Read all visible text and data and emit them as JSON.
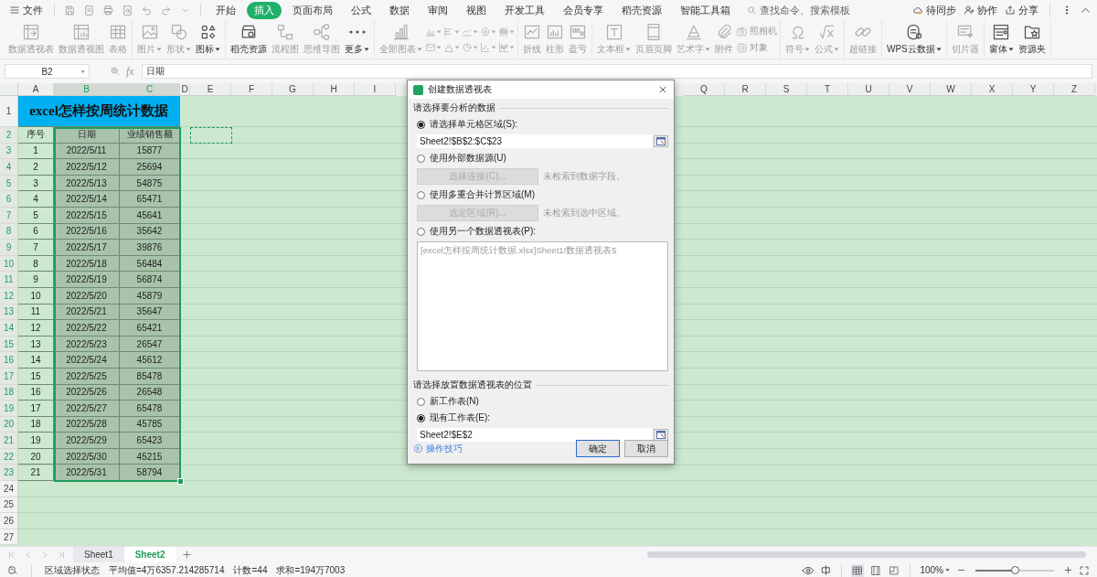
{
  "menu_bar": {
    "file_menu": "文件",
    "tabs": [
      {
        "label": "开始",
        "selected": false
      },
      {
        "label": "插入",
        "selected": true
      },
      {
        "label": "页面布局",
        "selected": false
      },
      {
        "label": "公式",
        "selected": false
      },
      {
        "label": "数据",
        "selected": false
      },
      {
        "label": "审阅",
        "selected": false
      },
      {
        "label": "视图",
        "selected": false
      },
      {
        "label": "开发工具",
        "selected": false
      },
      {
        "label": "会员专享",
        "selected": false
      },
      {
        "label": "稻壳资源",
        "selected": false
      },
      {
        "label": "智能工具箱",
        "selected": false
      }
    ],
    "search": {
      "placeholder": "查找命令、搜索模板"
    },
    "actions": [
      "待同步",
      "协作",
      "分享"
    ]
  },
  "ribbon": {
    "groups": [
      {
        "items": [
          {
            "kind": "large",
            "label": "数据透视表",
            "disabled": true,
            "dropdown": false
          },
          {
            "kind": "large",
            "label": "数据透视图",
            "disabled": true,
            "dropdown": false
          },
          {
            "kind": "large",
            "label": "表格",
            "disabled": true,
            "dropdown": false
          }
        ]
      },
      {
        "items": [
          {
            "kind": "large",
            "label": "图片",
            "disabled": true,
            "dropdown": true
          },
          {
            "kind": "large",
            "label": "形状",
            "disabled": true,
            "dropdown": true
          },
          {
            "kind": "large",
            "label": "图标",
            "disabled": false,
            "dropdown": true
          }
        ]
      },
      {
        "items": [
          {
            "kind": "large",
            "label": "稻壳资源",
            "disabled": false,
            "dropdown": false
          },
          {
            "kind": "large",
            "label": "流程图",
            "disabled": true,
            "dropdown": false
          },
          {
            "kind": "large",
            "label": "思维导图",
            "disabled": true,
            "dropdown": false
          },
          {
            "kind": "large",
            "label": "更多",
            "disabled": false,
            "dropdown": true
          }
        ]
      },
      {
        "items": [
          {
            "kind": "large",
            "label": "全部图表",
            "disabled": true,
            "dropdown": true
          },
          {
            "kind": "small",
            "disabled": true,
            "dropdown": true
          },
          {
            "kind": "small",
            "disabled": true,
            "dropdown": true
          },
          {
            "kind": "small",
            "disabled": true,
            "dropdown": true
          },
          {
            "kind": "small",
            "disabled": true,
            "dropdown": true
          },
          {
            "kind": "small",
            "disabled": true,
            "dropdown": true
          },
          {
            "kind": "small",
            "disabled": true,
            "dropdown": true
          },
          {
            "kind": "small",
            "disabled": true,
            "dropdown": true
          },
          {
            "kind": "small",
            "disabled": true,
            "dropdown": true
          },
          {
            "kind": "small",
            "disabled": true,
            "dropdown": true
          },
          {
            "kind": "small",
            "disabled": true,
            "dropdown": true
          }
        ]
      },
      {
        "items": [
          {
            "kind": "large",
            "label": "折线",
            "disabled": true,
            "dropdown": false
          },
          {
            "kind": "large",
            "label": "柱形",
            "disabled": true,
            "dropdown": false
          },
          {
            "kind": "large",
            "label": "盈亏",
            "disabled": true,
            "dropdown": false
          }
        ]
      },
      {
        "items": [
          {
            "kind": "large",
            "label": "文本框",
            "disabled": true,
            "dropdown": true
          },
          {
            "kind": "large",
            "label": "页眉页脚",
            "disabled": true,
            "dropdown": false
          },
          {
            "kind": "large",
            "label": "艺术字",
            "disabled": true,
            "dropdown": true
          },
          {
            "kind": "large",
            "label": "附件",
            "disabled": true,
            "dropdown": false
          },
          {
            "kind": "compact",
            "label": "照相机",
            "disabled": true,
            "dropdown": false
          },
          {
            "kind": "compact",
            "label": "对象",
            "disabled": true,
            "dropdown": false
          }
        ]
      },
      {
        "items": [
          {
            "kind": "large",
            "label": "符号",
            "disabled": true,
            "dropdown": true
          },
          {
            "kind": "large",
            "label": "公式",
            "disabled": true,
            "dropdown": true
          }
        ]
      },
      {
        "items": [
          {
            "kind": "large",
            "label": "超链接",
            "disabled": true,
            "dropdown": false
          }
        ]
      },
      {
        "items": [
          {
            "kind": "large",
            "label": "WPS云数据",
            "disabled": false,
            "dropdown": true
          }
        ]
      },
      {
        "items": [
          {
            "kind": "large",
            "label": "切片器",
            "disabled": true,
            "dropdown": false
          }
        ]
      },
      {
        "items": [
          {
            "kind": "large",
            "label": "窗体",
            "disabled": false,
            "dropdown": true
          },
          {
            "kind": "large",
            "label": "资源夹",
            "disabled": false,
            "dropdown": false
          }
        ]
      }
    ]
  },
  "formula_bar": {
    "name_box": "B2",
    "function_label": "fx",
    "formula": "日期"
  },
  "sheet": {
    "columns": [
      {
        "label": "A",
        "selected": false
      },
      {
        "label": "B",
        "selected": true
      },
      {
        "label": "C",
        "selected": true
      },
      {
        "label": "D",
        "selected": false
      },
      {
        "label": "E",
        "selected": false
      },
      {
        "label": "F",
        "selected": false
      },
      {
        "label": "G",
        "selected": false
      },
      {
        "label": "H",
        "selected": false
      },
      {
        "label": "I",
        "selected": false
      },
      {
        "label": "Q",
        "selected": false
      },
      {
        "label": "R",
        "selected": false
      },
      {
        "label": "S",
        "selected": false
      },
      {
        "label": "T",
        "selected": false
      },
      {
        "label": "U",
        "selected": false
      },
      {
        "label": "V",
        "selected": false
      },
      {
        "label": "W",
        "selected": false
      },
      {
        "label": "X",
        "selected": false
      },
      {
        "label": "Y",
        "selected": false
      },
      {
        "label": "Z",
        "selected": false
      }
    ],
    "rows": [
      {
        "label": "1",
        "selected": false
      },
      {
        "label": "2",
        "selected": true
      },
      {
        "label": "3",
        "selected": true
      },
      {
        "label": "4",
        "selected": true
      },
      {
        "label": "5",
        "selected": true
      },
      {
        "label": "6",
        "selected": true
      },
      {
        "label": "7",
        "selected": true
      },
      {
        "label": "8",
        "selected": true
      },
      {
        "label": "9",
        "selected": true
      },
      {
        "label": "10",
        "selected": true
      },
      {
        "label": "11",
        "selected": true
      },
      {
        "label": "12",
        "selected": true
      },
      {
        "label": "13",
        "selected": true
      },
      {
        "label": "14",
        "selected": true
      },
      {
        "label": "15",
        "selected": true
      },
      {
        "label": "16",
        "selected": true
      },
      {
        "label": "17",
        "selected": true
      },
      {
        "label": "18",
        "selected": true
      },
      {
        "label": "19",
        "selected": true
      },
      {
        "label": "20",
        "selected": true
      },
      {
        "label": "21",
        "selected": true
      },
      {
        "label": "22",
        "selected": true
      },
      {
        "label": "23",
        "selected": true
      },
      {
        "label": "24",
        "selected": false
      },
      {
        "label": "25",
        "selected": false
      },
      {
        "label": "26",
        "selected": false
      },
      {
        "label": "27",
        "selected": false
      }
    ],
    "title": "excel怎样按周统计数据",
    "table_header": [
      "序号",
      "日期",
      "业绩销售额"
    ],
    "table_rows": [
      [
        "1",
        "2022/5/11",
        "15877"
      ],
      [
        "2",
        "2022/5/12",
        "25694"
      ],
      [
        "3",
        "2022/5/13",
        "54875"
      ],
      [
        "4",
        "2022/5/14",
        "65471"
      ],
      [
        "5",
        "2022/5/15",
        "45641"
      ],
      [
        "6",
        "2022/5/16",
        "35642"
      ],
      [
        "7",
        "2022/5/17",
        "39876"
      ],
      [
        "8",
        "2022/5/18",
        "56484"
      ],
      [
        "9",
        "2022/5/19",
        "56874"
      ],
      [
        "10",
        "2022/5/20",
        "45879"
      ],
      [
        "11",
        "2022/5/21",
        "35647"
      ],
      [
        "12",
        "2022/5/22",
        "65421"
      ],
      [
        "13",
        "2022/5/23",
        "26547"
      ],
      [
        "14",
        "2022/5/24",
        "45612"
      ],
      [
        "15",
        "2022/5/25",
        "85478"
      ],
      [
        "16",
        "2022/5/26",
        "26548"
      ],
      [
        "17",
        "2022/5/27",
        "65478"
      ],
      [
        "18",
        "2022/5/28",
        "45785"
      ],
      [
        "19",
        "2022/5/29",
        "65423"
      ],
      [
        "20",
        "2022/5/30",
        "45215"
      ],
      [
        "21",
        "2022/5/31",
        "58794"
      ]
    ]
  },
  "dialog": {
    "title": "创建数据透视表",
    "source_section": {
      "heading": "请选择要分析的数据",
      "options": [
        {
          "kind": "range",
          "label": "请选择单元格区域(S):",
          "selected": true,
          "value": "Sheet2!$B$2:$C$23"
        },
        {
          "kind": "button",
          "label": "使用外部数据源(U)",
          "selected": false,
          "button": {
            "label": "选择连接(C)...",
            "disabled": true
          },
          "note": "未检索到数据字段。"
        },
        {
          "kind": "button",
          "label": "使用多重合并计算区域(M)",
          "selected": false,
          "button": {
            "label": "选定区域(R)...",
            "disabled": true
          },
          "note": "未检索到选中区域。"
        },
        {
          "kind": "list",
          "label": "使用另一个数据透视表(P):",
          "selected": false,
          "disabled": true,
          "items": [
            "[excel怎样按周统计数据.xlsx]Sheet1!数据透视表5"
          ]
        }
      ]
    },
    "destination_section": {
      "heading": "请选择放置数据透视表的位置",
      "options": [
        {
          "label": "新工作表(N)",
          "selected": false
        },
        {
          "label": "现有工作表(E):",
          "selected": true
        }
      ],
      "value": "Sheet2!$E$2"
    },
    "tips_link": "操作技巧",
    "buttons": [
      {
        "label": "确定",
        "default": true
      },
      {
        "label": "取消",
        "default": false
      }
    ]
  },
  "sheet_tabs": [
    {
      "label": "Sheet1",
      "selected": false
    },
    {
      "label": "Sheet2",
      "selected": true
    }
  ],
  "status_bar": {
    "mode": "区域选择状态",
    "stats": [
      "平均值=4万6357.214285714",
      "计数=44",
      "求和=194万7003"
    ],
    "views": [
      {
        "selected": true
      },
      {
        "selected": false
      },
      {
        "selected": false
      }
    ],
    "zoom": {
      "label": "100%",
      "level": 0.5
    }
  }
}
